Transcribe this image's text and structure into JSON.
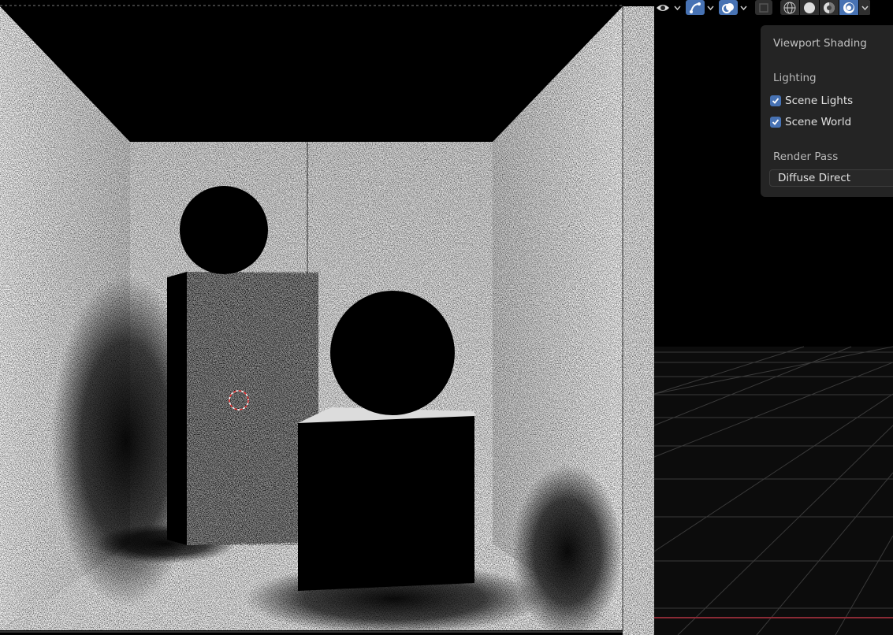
{
  "header": {
    "icons": [
      "eye-icon",
      "gizmo-icon",
      "overlay-icon",
      "xray-icon",
      "wireframe-shading-icon",
      "solid-shading-icon",
      "material-preview-icon",
      "rendered-shading-icon"
    ],
    "active_shading": "rendered"
  },
  "popover": {
    "title": "Viewport Shading",
    "lighting_label": "Lighting",
    "scene_lights": {
      "label": "Scene Lights",
      "checked": true
    },
    "scene_world": {
      "label": "Scene World",
      "checked": true
    },
    "render_pass_label": "Render Pass",
    "render_pass_value": "Diffuse Direct"
  },
  "colors": {
    "accent": "#4772b3",
    "panel_bg": "#242424",
    "grid_line": "#3a3a3a",
    "x_axis": "#8a2a35"
  }
}
